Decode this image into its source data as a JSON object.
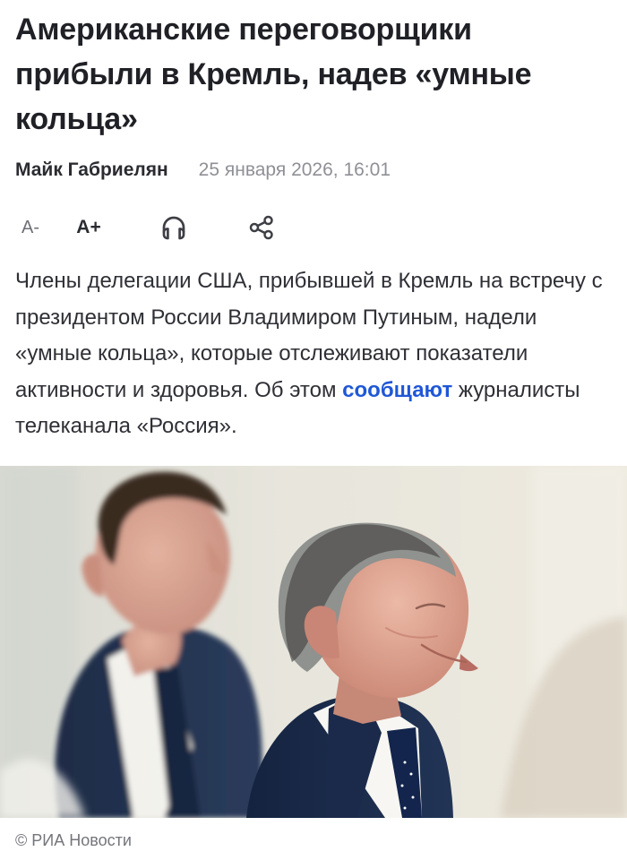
{
  "article": {
    "title": "Американские переговорщики прибыли в Кремль, надев «умные кольца»",
    "author": "Майк Габриелян",
    "date": "25 января 2026, 16:01",
    "lead_before_link": "Члены делегации США, прибывшей в Кремль на встречу с президентом России Владимиром Путиным, надели «умные кольца», которые отслеживают показатели активности и здоровья. Об этом ",
    "lead_link": "сообщают",
    "lead_after_link": " журналисты телеканала «Россия».",
    "photo_credit": "© РИА Новости"
  },
  "toolbar": {
    "font_decrease": "A-",
    "font_increase": "A+",
    "listen_icon": "headphones-icon",
    "share_icon": "share-icon"
  },
  "colors": {
    "link": "#1f57d6",
    "meta_gray": "#8f9096",
    "heading": "#202126"
  }
}
